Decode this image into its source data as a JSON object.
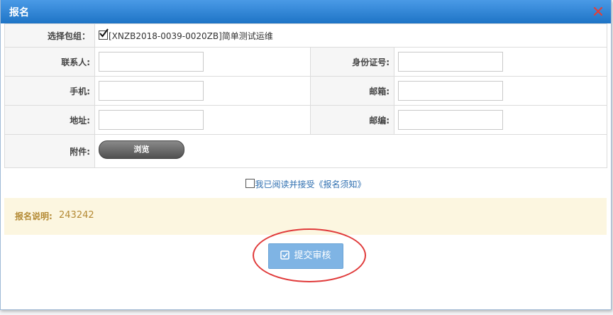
{
  "dialog": {
    "title": "报名",
    "close_icon": "close-icon"
  },
  "form": {
    "package_label": "选择包组：",
    "package_checked": true,
    "package_value": "[XNZB2018-0039-0020ZB]简单测试运维",
    "contact_label": "联系人:",
    "contact_value": "",
    "id_label": "身份证号:",
    "id_value": "",
    "mobile_label": "手机:",
    "mobile_value": "",
    "email_label": "邮箱:",
    "email_value": "",
    "address_label": "地址:",
    "address_value": "",
    "postcode_label": "邮编:",
    "postcode_value": "",
    "attachment_label": "附件:",
    "browse_label": "浏览"
  },
  "agreement": {
    "checked": false,
    "text": "我已阅读并接受",
    "link": "《报名须知》"
  },
  "notice": {
    "label": "报名说明:",
    "value": "243242"
  },
  "submit": {
    "label": "提交审核",
    "icon": "check-square-icon"
  },
  "colors": {
    "titlebar": "#2e86d9",
    "notice_bg": "#fcf6e0",
    "notice_text": "#b48a34",
    "submit_bg": "#7fb4e4",
    "highlight_circle": "#e03a3a",
    "link": "#2f6fb0"
  }
}
